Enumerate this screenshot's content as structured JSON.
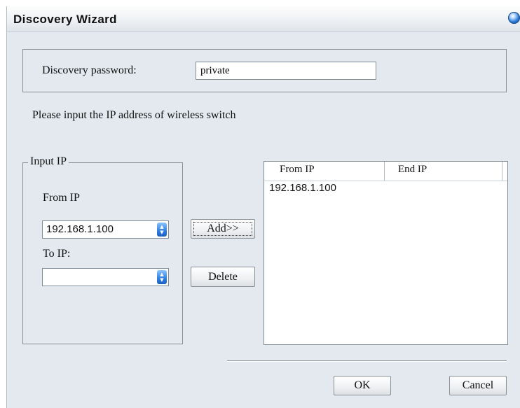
{
  "window": {
    "title": "Discovery Wizard",
    "help_icon": "help-orb-icon"
  },
  "password": {
    "label": "Discovery password:",
    "value": "private"
  },
  "instruction": "Please input the IP address of wireless switch",
  "input_ip": {
    "legend": "Input IP",
    "from_label": "From IP",
    "from_value": "192.168.1.100",
    "to_label": "To IP:",
    "to_value": ""
  },
  "buttons": {
    "add": "Add>>",
    "delete": "Delete",
    "ok": "OK",
    "cancel": "Cancel"
  },
  "ip_list": {
    "columns": [
      "From IP",
      "End IP"
    ],
    "rows": [
      {
        "from": "192.168.1.100",
        "end": ""
      }
    ]
  },
  "colors": {
    "dialog_background": "#e3e9ef",
    "combo_arrow": "#2f7fe0"
  }
}
